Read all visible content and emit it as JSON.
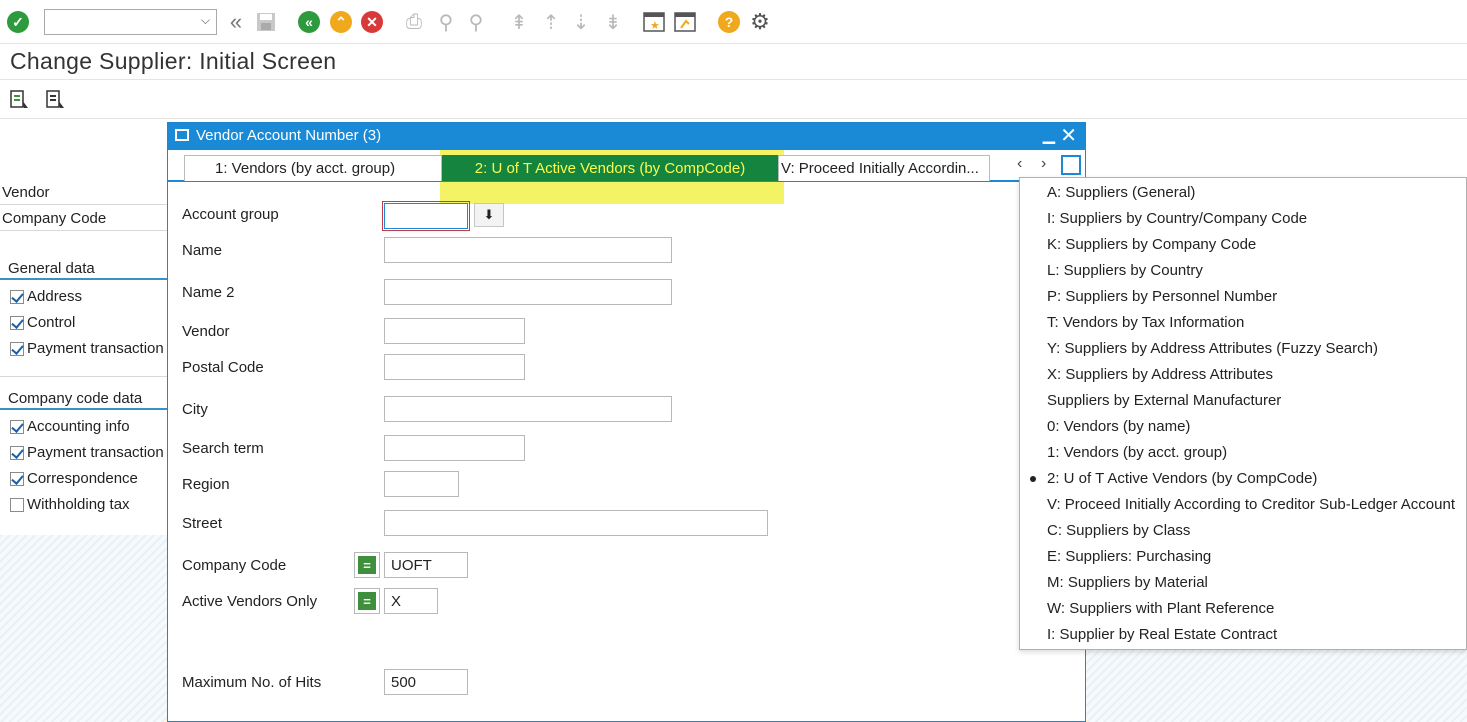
{
  "toolbar": {
    "command_field_value": "",
    "colors": {
      "ok": "#2e9a3e",
      "back": "#2e9a3e",
      "exit": "#f0a81c",
      "cancel": "#d83a3a",
      "help": "#f0a81c"
    }
  },
  "page": {
    "title": "Change Supplier:  Initial Screen"
  },
  "left_panel": {
    "vendor_label": "Vendor",
    "company_code_label": "Company Code",
    "general_data": {
      "heading": "General data",
      "items": [
        {
          "label": "Address",
          "checked": true
        },
        {
          "label": "Control",
          "checked": true
        },
        {
          "label": "Payment transaction",
          "checked": true
        }
      ]
    },
    "company_code_data": {
      "heading": "Company code data",
      "items": [
        {
          "label": "Accounting info",
          "checked": true
        },
        {
          "label": "Payment transaction",
          "checked": true
        },
        {
          "label": "Correspondence",
          "checked": true
        },
        {
          "label": "Withholding tax",
          "checked": false
        }
      ]
    }
  },
  "dialog": {
    "title": "Vendor Account Number (3)",
    "tabs": [
      {
        "label": "1: Vendors (by acct. group)",
        "active": false
      },
      {
        "label": "2: U of T Active Vendors (by CompCode)",
        "active": true
      },
      {
        "label": "V: Proceed Initially Accordin...",
        "active": false
      }
    ],
    "fields": {
      "account_group": {
        "label": "Account group",
        "value": ""
      },
      "name": {
        "label": "Name",
        "value": ""
      },
      "name2": {
        "label": "Name 2",
        "value": ""
      },
      "vendor": {
        "label": "Vendor",
        "value": ""
      },
      "postal_code": {
        "label": "Postal Code",
        "value": ""
      },
      "city": {
        "label": "City",
        "value": ""
      },
      "search_term": {
        "label": "Search term",
        "value": ""
      },
      "region": {
        "label": "Region",
        "value": ""
      },
      "street": {
        "label": "Street",
        "value": ""
      },
      "company_code": {
        "label": "Company Code",
        "value": "UOFT"
      },
      "active_vendors_only": {
        "label": "Active Vendors Only",
        "value": "X"
      },
      "max_hits": {
        "label": "Maximum No. of Hits",
        "value": "500"
      }
    }
  },
  "search_help_list": {
    "selected_index": 11,
    "items": [
      "A: Suppliers (General)",
      "I: Suppliers by Country/Company Code",
      "K: Suppliers by Company Code",
      "L: Suppliers by Country",
      "P: Suppliers by Personnel Number",
      "T: Vendors by Tax Information",
      "Y: Suppliers by Address Attributes (Fuzzy Search)",
      "X: Suppliers by Address Attributes",
      "Suppliers by External Manufacturer",
      "0: Vendors (by name)",
      "1: Vendors (by acct. group)",
      "2: U of T Active Vendors (by CompCode)",
      "V: Proceed Initially According to Creditor Sub-Ledger Account",
      "C: Suppliers by Class",
      "E: Suppliers: Purchasing",
      "M: Suppliers by Material",
      "W: Suppliers with Plant Reference",
      "I: Supplier by Real Estate Contract"
    ]
  }
}
